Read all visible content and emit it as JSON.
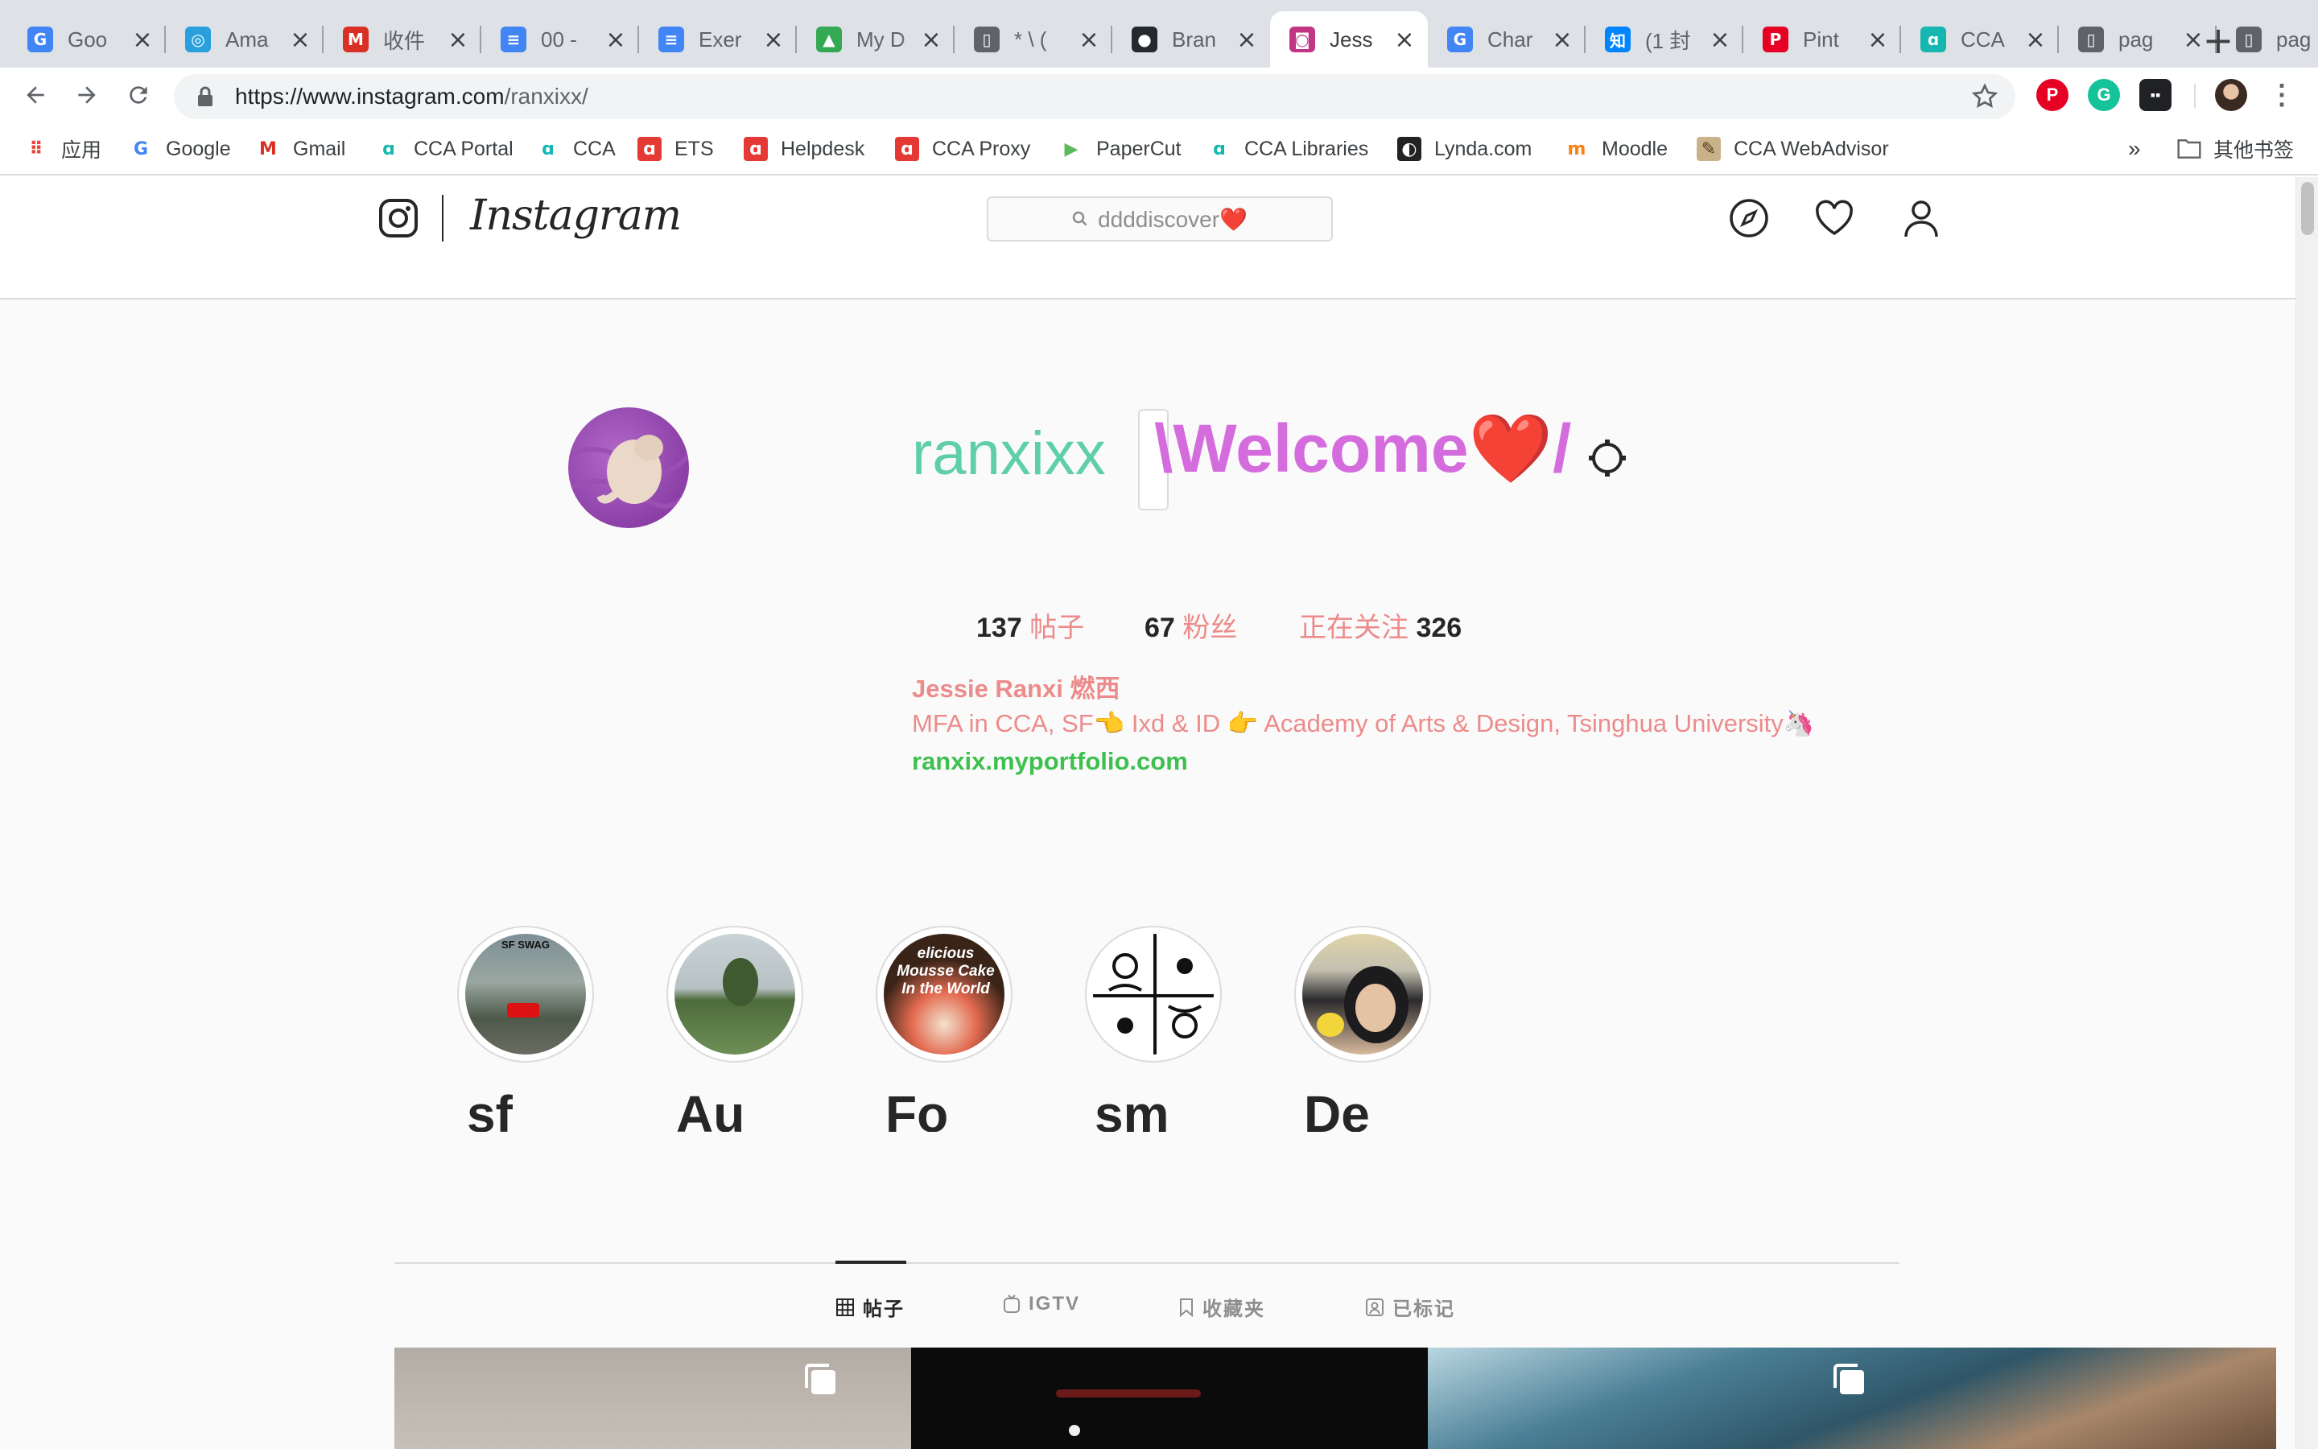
{
  "browser": {
    "tabs": [
      {
        "label": "Goo",
        "icon": "google-translate-icon",
        "color": "#4285f4"
      },
      {
        "label": "Ama",
        "icon": "safari-compass-icon",
        "color": "#29a0dc"
      },
      {
        "label": "收件",
        "icon": "gmail-icon",
        "color": "#d93025"
      },
      {
        "label": "00 -",
        "icon": "google-docs-icon",
        "color": "#4285f4"
      },
      {
        "label": "Exer",
        "icon": "google-docs-icon",
        "color": "#4285f4"
      },
      {
        "label": "My D",
        "icon": "google-drive-icon",
        "color": "#34a853"
      },
      {
        "label": "* \\ (",
        "icon": "document-icon",
        "color": "#5f6368"
      },
      {
        "label": "Bran",
        "icon": "github-icon",
        "color": "#24292e"
      },
      {
        "label": "Jess",
        "icon": "instagram-icon",
        "color": "#c13584"
      },
      {
        "label": "Char",
        "icon": "google-icon",
        "color": "#4285f4"
      },
      {
        "label": "(1 封",
        "icon": "zhihu-icon",
        "color": "#0084ff"
      },
      {
        "label": "Pint",
        "icon": "pinterest-icon",
        "color": "#e60023"
      },
      {
        "label": "CCA",
        "icon": "cca-icon",
        "color": "#15b7b0"
      },
      {
        "label": "pag",
        "icon": "document-icon",
        "color": "#5f6368"
      },
      {
        "label": "pag",
        "icon": "document-icon",
        "color": "#5f6368"
      }
    ],
    "address": {
      "domain": "https://www.instagram.com",
      "path": "/ranxixx/"
    },
    "bookmarks": [
      {
        "label": "应用",
        "icon": "apps-grid-icon"
      },
      {
        "label": "Google",
        "icon": "google-icon"
      },
      {
        "label": "Gmail",
        "icon": "gmail-icon"
      },
      {
        "label": "CCA Portal",
        "icon": "cca-icon"
      },
      {
        "label": "CCA",
        "icon": "cca-icon"
      },
      {
        "label": "ETS",
        "icon": "cca-red-icon"
      },
      {
        "label": "Helpdesk",
        "icon": "cca-red-icon"
      },
      {
        "label": "CCA Proxy",
        "icon": "cca-red-icon"
      },
      {
        "label": "PaperCut",
        "icon": "papercut-icon"
      },
      {
        "label": "CCA Libraries",
        "icon": "cca-icon"
      },
      {
        "label": "Lynda.com",
        "icon": "lynda-icon"
      },
      {
        "label": "Moodle",
        "icon": "moodle-icon"
      },
      {
        "label": "CCA WebAdvisor",
        "icon": "webadvisor-icon"
      }
    ],
    "bookmarks_more": "»",
    "other_bookmarks": "其他书签"
  },
  "instagram": {
    "wordmark": "Instagram",
    "search_placeholder": "ddddiscover❤️",
    "profile": {
      "username": "ranxixx",
      "welcome": "\\Welcome❤️/",
      "stats": {
        "posts_count": "137",
        "posts_label": "帖子",
        "followers_count": "67",
        "followers_label": "粉丝",
        "following_label": "正在关注",
        "following_count": "326"
      },
      "full_name": "Jessie Ranxi 燃西",
      "bio": "MFA in CCA, SF👈  Ixd & ID 👉 Academy of Arts & Design, Tsinghua University🦄",
      "website": "ranxix.myportfolio.com"
    },
    "highlights": [
      {
        "label": "sf",
        "badge": "SF SWAG"
      },
      {
        "label": "Au",
        "badge": ""
      },
      {
        "label": "Fo",
        "badge": "elicious Mousse Cake In the World"
      },
      {
        "label": "sm",
        "badge": ""
      },
      {
        "label": "De",
        "badge": ""
      }
    ],
    "profile_tabs": [
      "帖子",
      "IGTV",
      "收藏夹",
      "已标记"
    ]
  },
  "colors": {
    "username": "#5ecfa9",
    "welcome": "#d46cde",
    "bio": "#ed8b8b",
    "link": "#3ec04f"
  }
}
